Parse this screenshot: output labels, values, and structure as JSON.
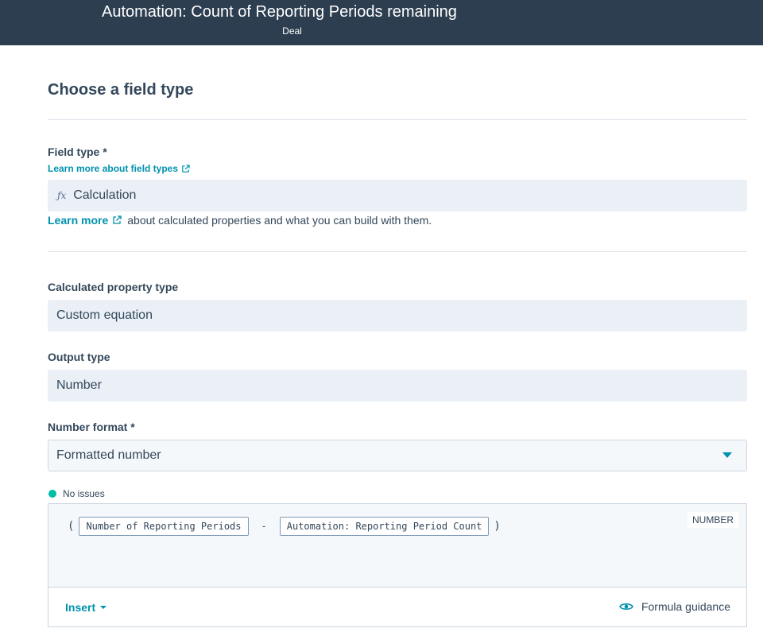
{
  "header": {
    "title": "Automation: Count of Reporting Periods remaining",
    "subtitle": "Deal"
  },
  "section": {
    "title": "Choose a field type"
  },
  "field_type": {
    "label": "Field type *",
    "learn_link": "Learn more about field types",
    "value": "Calculation",
    "icon": "fx-icon",
    "learn_more_link": "Learn more",
    "learn_more_text": "about calculated properties and what you can build with them."
  },
  "calculated_type": {
    "label": "Calculated property type",
    "value": "Custom equation"
  },
  "output_type": {
    "label": "Output type",
    "value": "Number"
  },
  "number_format": {
    "label": "Number format *",
    "value": "Formatted number"
  },
  "validation": {
    "status": "No issues",
    "status_color": "#00bda5"
  },
  "formula": {
    "open_paren": "(",
    "operand1": "Number of Reporting Periods",
    "operator": "-",
    "operand2": "Automation: Reporting Period Count",
    "close_paren": ")",
    "output_badge": "NUMBER"
  },
  "editor_footer": {
    "insert_label": "Insert",
    "guidance_label": "Formula guidance"
  }
}
